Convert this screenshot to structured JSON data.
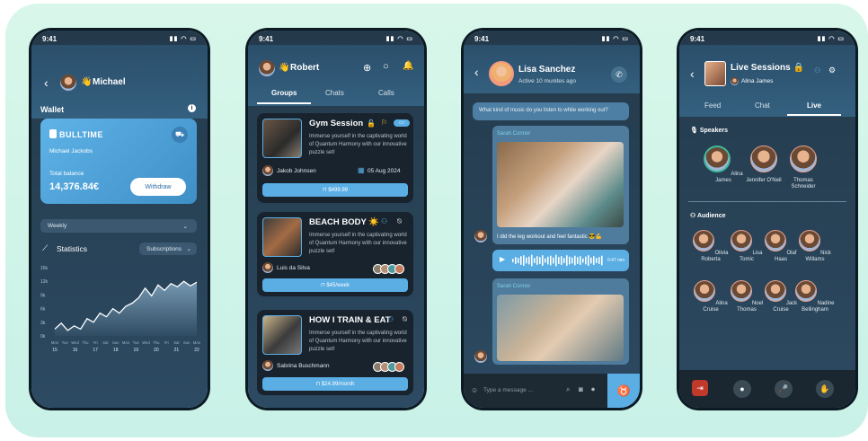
{
  "status_time": "9:41",
  "wallet": {
    "user": "Michael",
    "title": "Wallet",
    "brand": "BULLTIME",
    "card_holder": "Michael Jackobs",
    "balance_label": "Total balance",
    "balance": "14,376.84€",
    "withdraw": "Withdraw",
    "period": "Weekly",
    "stats_title": "Statistics",
    "stats_filter": "Subscriptions",
    "chart_data": {
      "type": "area",
      "y_ticks": [
        "15k",
        "12k",
        "9k",
        "6k",
        "3k",
        "0k"
      ],
      "x_days": [
        "Mon",
        "Tue",
        "Wed",
        "Thu",
        "Fri",
        "Sat",
        "Sun",
        "Mon",
        "Tue",
        "Wed",
        "Thu",
        "Fri",
        "Sat",
        "Sun",
        "Mon"
      ],
      "x_dates": [
        "15",
        "",
        "16",
        "",
        "17",
        "",
        "18",
        "",
        "19",
        "",
        "20",
        "",
        "21",
        "",
        "22"
      ],
      "values": [
        1.5,
        2.8,
        1.2,
        2.2,
        1.5,
        3.8,
        3.0,
        5.0,
        4.2,
        6.0,
        5.0,
        6.5,
        7.2,
        8.4,
        10.5,
        8.8,
        11.2,
        10.0,
        11.5,
        10.8,
        12.0,
        11.0,
        11.8
      ],
      "ylim": [
        0,
        15
      ]
    }
  },
  "groups": {
    "user": "Robert",
    "tabs": [
      "Groups",
      "Chats",
      "Calls"
    ],
    "cards": [
      {
        "title": "Gym Session",
        "desc": "Immerse yourself in the captivating world of Quantum Harmony with our innovative puzzle set!",
        "author": "Jakob Johnsen",
        "date": "05 Aug 2024",
        "price": "$499.99"
      },
      {
        "title": "BEACH BODY ☀️",
        "desc": "Immerse yourself in the captivating world of Quantum Harmony with our innovative puzzle set!",
        "author": "Luis da Silva",
        "price": "$45/week"
      },
      {
        "title": "HOW I TRAIN & EAT",
        "desc": "Immerse yourself in the captivating world of Quantum Harmony with our innovative puzzle set!",
        "author": "Sabrina Buschmann",
        "price": "$24.99/month"
      }
    ]
  },
  "chat": {
    "name": "Lisa Sanchez",
    "presence": "Active 10 munites ago",
    "question": "What kind of music do you listen to while working out?",
    "sender": "Sarah Connor",
    "message": "I did the leg workout and feel fantastic 😎💪",
    "audio_time": "0:47 min",
    "sender2": "Sarah Connor",
    "placeholder": "Type a message ..."
  },
  "live": {
    "title": "Live Sessions 🔒",
    "host": "Alina James",
    "tabs": [
      "Feed",
      "Chat",
      "Live"
    ],
    "speakers_label": "Speakers",
    "speakers": [
      "Alina James",
      "Jennifer O'Neil",
      "Thomas Schneider"
    ],
    "audience_label": "Audience",
    "audience": [
      "Olivia Roberta",
      "Lisa Tomic",
      "Olaf Haas",
      "Nick Willams",
      "Alina Cruise",
      "Noel Thomas",
      "Jack Cruise",
      "Nadine Bellingham"
    ]
  }
}
